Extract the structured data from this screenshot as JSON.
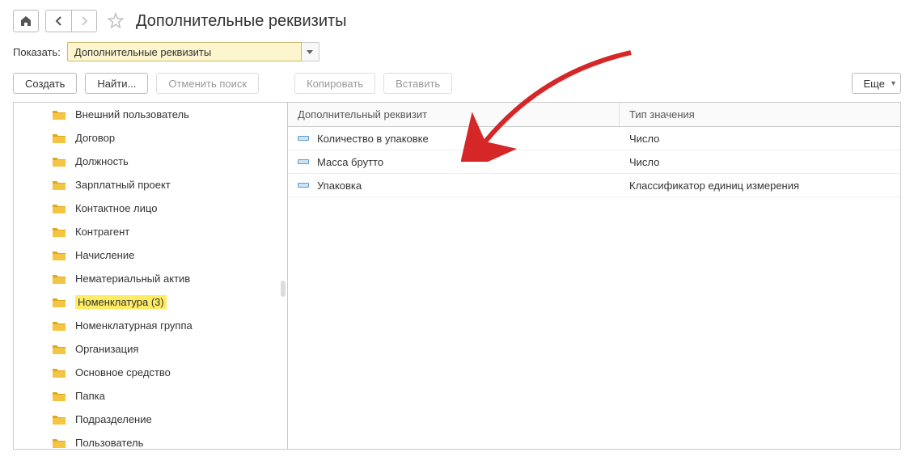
{
  "page_title": "Дополнительные реквизиты",
  "filter": {
    "label": "Показать:",
    "value": "Дополнительные реквизиты"
  },
  "toolbar": {
    "create": "Создать",
    "find": "Найти...",
    "cancel_search": "Отменить поиск",
    "copy": "Копировать",
    "paste": "Вставить",
    "more": "Еще"
  },
  "tree": {
    "items": [
      {
        "label": "Внешний пользователь"
      },
      {
        "label": "Договор"
      },
      {
        "label": "Должность"
      },
      {
        "label": "Зарплатный проект"
      },
      {
        "label": "Контактное лицо"
      },
      {
        "label": "Контрагент"
      },
      {
        "label": "Начисление"
      },
      {
        "label": "Нематериальный актив"
      },
      {
        "label": "Номенклатура (3)",
        "highlighted": true
      },
      {
        "label": "Номенклатурная группа"
      },
      {
        "label": "Организация"
      },
      {
        "label": "Основное средство"
      },
      {
        "label": "Папка"
      },
      {
        "label": "Подразделение"
      },
      {
        "label": "Пользователь"
      }
    ]
  },
  "table": {
    "columns": [
      "Дополнительный реквизит",
      "Тип значения"
    ],
    "rows": [
      {
        "name": "Количество в упаковке",
        "type": "Число"
      },
      {
        "name": "Масса брутто",
        "type": "Число"
      },
      {
        "name": "Упаковка",
        "type": "Классификатор единиц измерения"
      }
    ]
  }
}
